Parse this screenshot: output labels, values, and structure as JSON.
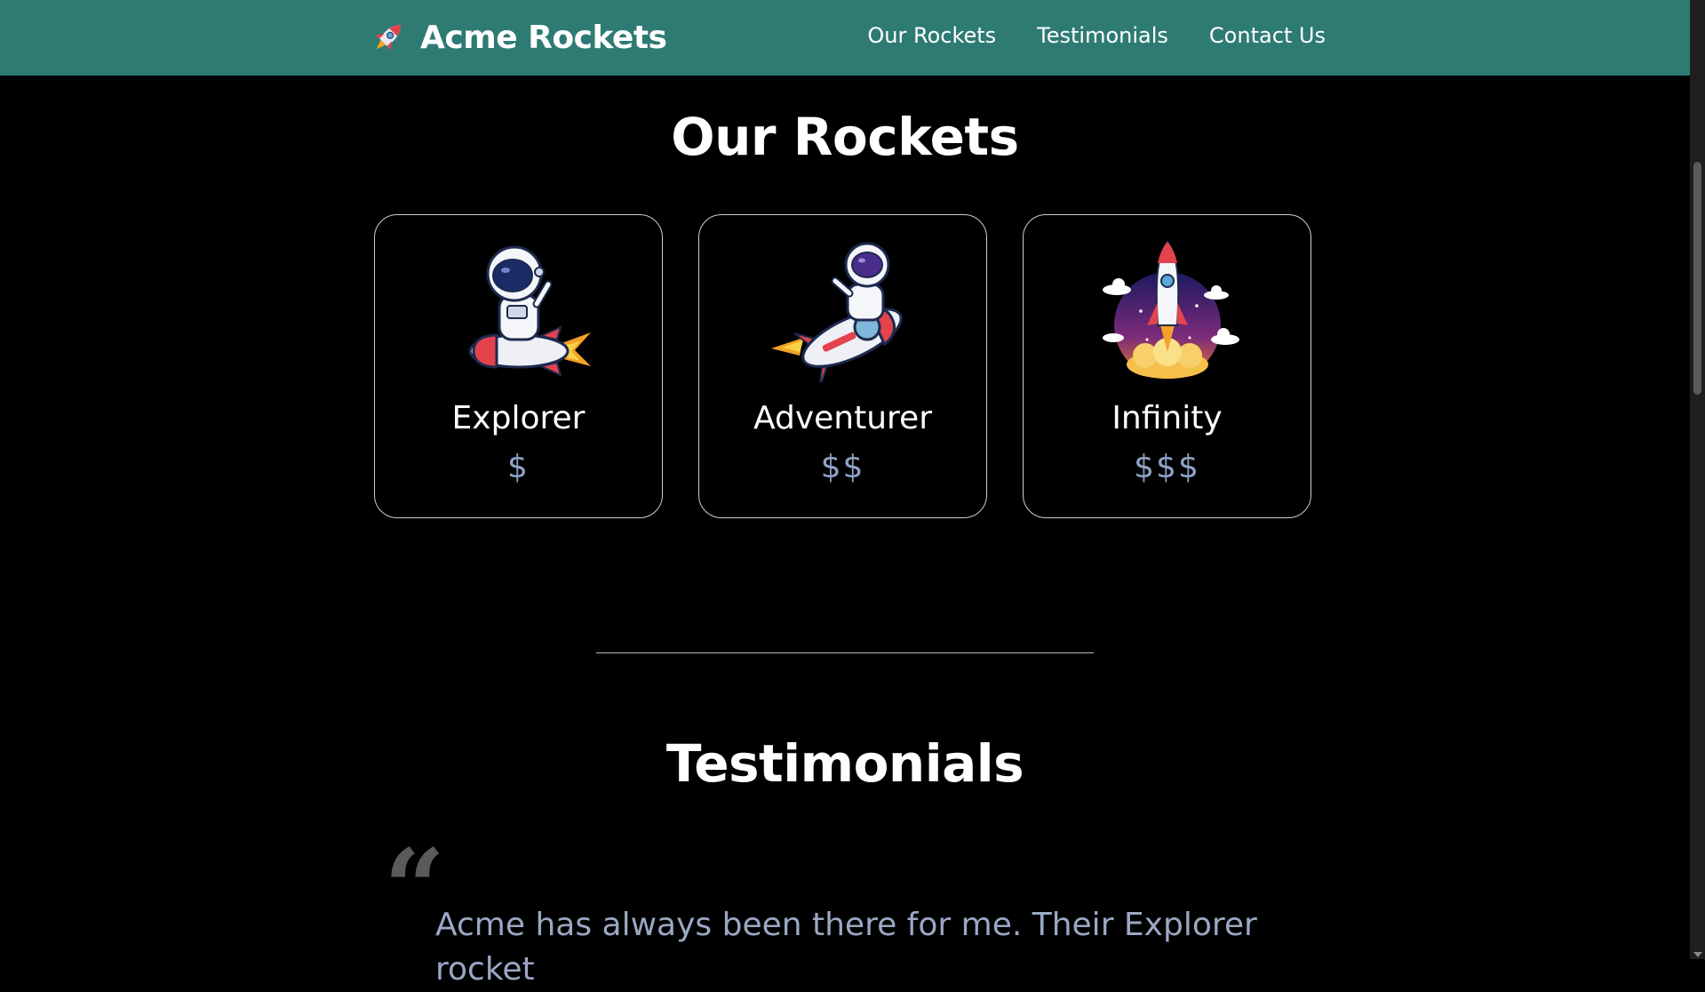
{
  "header": {
    "brand_title": "Acme Rockets",
    "brand_icon": "rocket-icon",
    "nav": [
      "Our Rockets",
      "Testimonials",
      "Contact Us"
    ]
  },
  "rockets": {
    "title": "Our Rockets",
    "cards": [
      {
        "name": "Explorer",
        "price": "$",
        "image": "astronaut-riding-rocket-image"
      },
      {
        "name": "Adventurer",
        "price": "$$",
        "image": "astronaut-flying-rocket-image"
      },
      {
        "name": "Infinity",
        "price": "$$$",
        "image": "rocket-launch-image"
      }
    ]
  },
  "testimonials": {
    "title": "Testimonials",
    "quote_mark": "“",
    "quote": "Acme has always been there for me. Their Explorer rocket"
  },
  "colors": {
    "navbar": "#2e7b74",
    "background": "#000000",
    "price_text": "#8fa3c6",
    "quote_text": "#9aa8c4"
  }
}
